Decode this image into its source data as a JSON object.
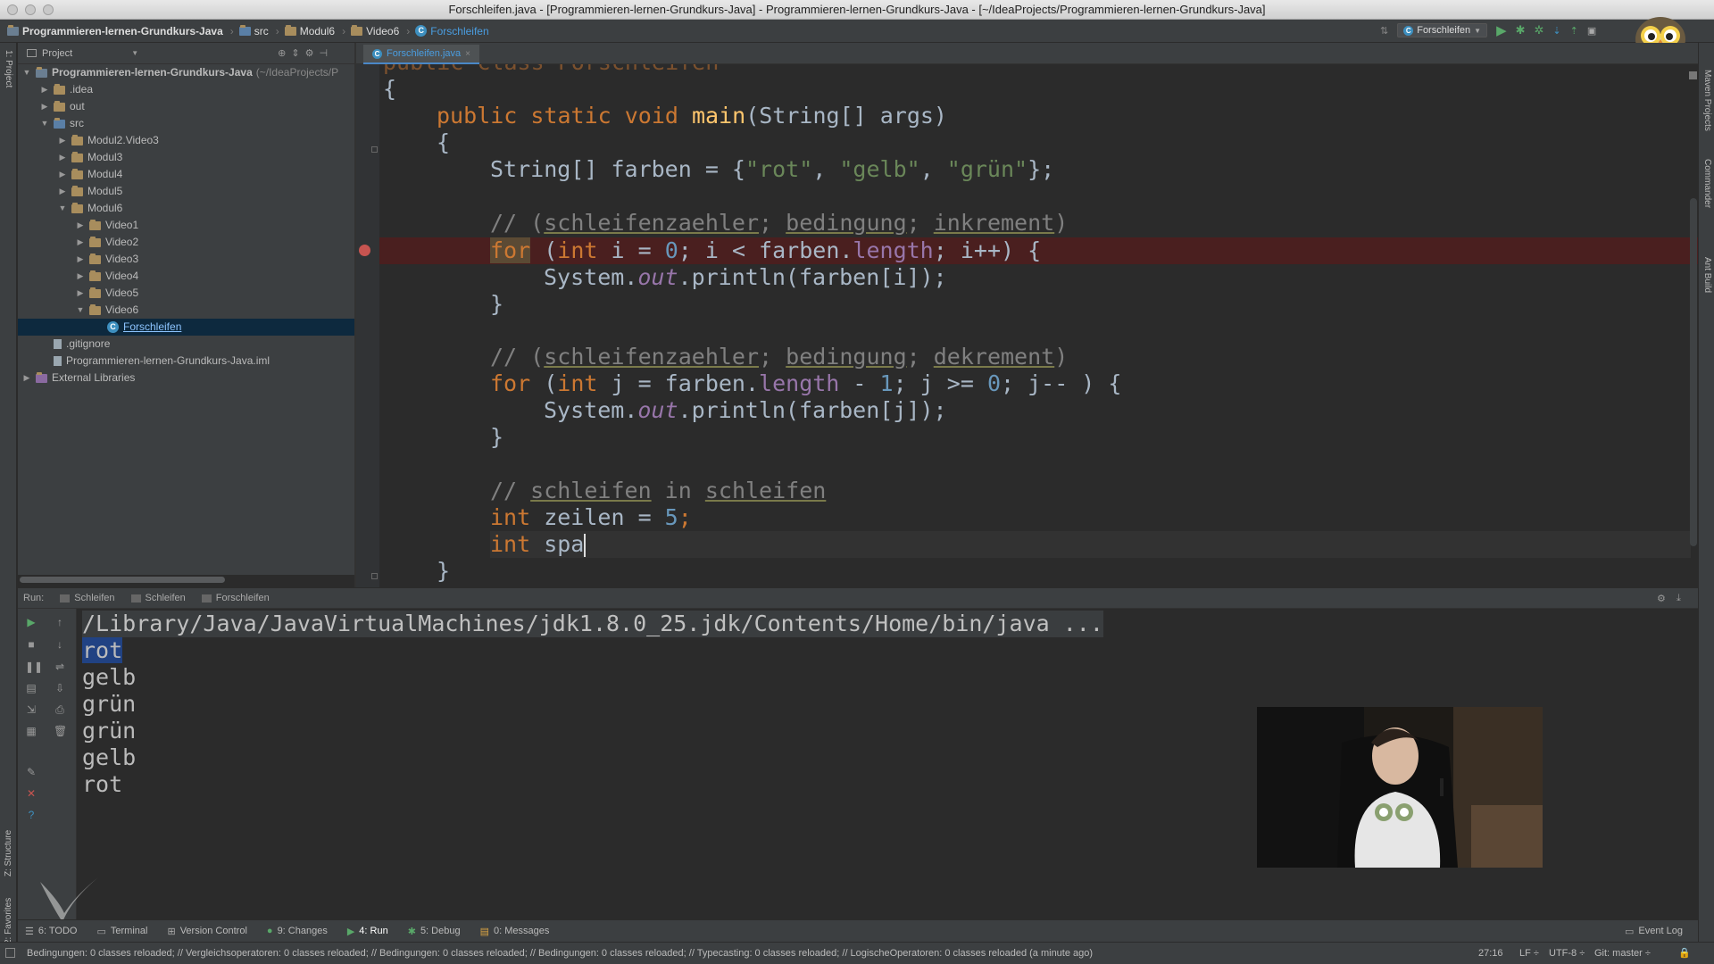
{
  "window_title": "Forschleifen.java - [Programmieren-lernen-Grundkurs-Java] - Programmieren-lernen-Grundkurs-Java - [~/IdeaProjects/Programmieren-lernen-Grundkurs-Java]",
  "breadcrumbs": [
    "Programmieren-lernen-Grundkurs-Java",
    "src",
    "Modul6",
    "Video6",
    "Forschleifen"
  ],
  "run_config": "Forschleifen",
  "project_panel": {
    "label": "Project"
  },
  "tree": [
    {
      "label": "Programmieren-lernen-Grundkurs-Java",
      "sub": "(~/IdeaProjects/P",
      "depth": 0,
      "arrow": "▼",
      "icon": "project-folder-icon"
    },
    {
      "label": ".idea",
      "depth": 1,
      "arrow": "▶",
      "icon": "folder-icon"
    },
    {
      "label": "out",
      "depth": 1,
      "arrow": "▶",
      "icon": "folder-icon"
    },
    {
      "label": "src",
      "depth": 1,
      "arrow": "▼",
      "icon": "source-folder-icon"
    },
    {
      "label": "Modul2.Video3",
      "depth": 2,
      "arrow": "▶",
      "icon": "package-icon"
    },
    {
      "label": "Modul3",
      "depth": 2,
      "arrow": "▶",
      "icon": "package-icon"
    },
    {
      "label": "Modul4",
      "depth": 2,
      "arrow": "▶",
      "icon": "package-icon"
    },
    {
      "label": "Modul5",
      "depth": 2,
      "arrow": "▶",
      "icon": "package-icon"
    },
    {
      "label": "Modul6",
      "depth": 2,
      "arrow": "▼",
      "icon": "package-icon"
    },
    {
      "label": "Video1",
      "depth": 3,
      "arrow": "▶",
      "icon": "package-icon"
    },
    {
      "label": "Video2",
      "depth": 3,
      "arrow": "▶",
      "icon": "package-icon"
    },
    {
      "label": "Video3",
      "depth": 3,
      "arrow": "▶",
      "icon": "package-icon"
    },
    {
      "label": "Video4",
      "depth": 3,
      "arrow": "▶",
      "icon": "package-icon"
    },
    {
      "label": "Video5",
      "depth": 3,
      "arrow": "▶",
      "icon": "package-icon"
    },
    {
      "label": "Video6",
      "depth": 3,
      "arrow": "▼",
      "icon": "package-icon"
    },
    {
      "label": "Forschleifen",
      "depth": 4,
      "arrow": "",
      "icon": "java-class-icon",
      "selected": true
    },
    {
      "label": ".gitignore",
      "depth": 1,
      "arrow": "",
      "icon": "file-icon"
    },
    {
      "label": "Programmieren-lernen-Grundkurs-Java.iml",
      "depth": 1,
      "arrow": "",
      "icon": "module-file-icon"
    },
    {
      "label": "External Libraries",
      "depth": 0,
      "arrow": "▶",
      "icon": "library-icon"
    }
  ],
  "editor_tab": "Forschleifen.java",
  "code": {
    "l0": "public class Forschleifen",
    "l1": "{",
    "l2a": "public static void ",
    "l2b": "main",
    "l2c": "(String[] args)",
    "l3": "{",
    "l4a": "String[] farben = {",
    "l4b": "\"rot\"",
    "l4c": ", ",
    "l4d": "\"gelb\"",
    "l4e": ", ",
    "l4f": "\"grün\"",
    "l4g": "};",
    "l5a": "// (",
    "l5b": "schleifenzaehler",
    "l5c": "; ",
    "l5d": "bedingung",
    "l5e": "; ",
    "l5f": "inkrement",
    "l5g": ")",
    "l6a": "for",
    "l6b": " (",
    "l6c": "int",
    "l6d": " i = ",
    "l6e": "0",
    "l6f": "; i < farben.",
    "l6g": "length",
    "l6h": "; i++) {",
    "l7a": "System.",
    "l7b": "out",
    "l7c": ".println(farben[i]);",
    "l8": "}",
    "l9a": "// (",
    "l9b": "schleifenzaehler",
    "l9c": "; ",
    "l9d": "bedingung",
    "l9e": "; ",
    "l9f": "dekrement",
    "l9g": ")",
    "l10a": "for",
    "l10b": " (",
    "l10c": "int",
    "l10d": " j = farben.",
    "l10e": "length",
    "l10f": " - ",
    "l10g": "1",
    "l10h": "; j >= ",
    "l10i": "0",
    "l10j": "; j-- ) {",
    "l11a": "System.",
    "l11b": "out",
    "l11c": ".println(farben[j]);",
    "l12": "}",
    "l13a": "// ",
    "l13b": "schleifen",
    "l13c": " in ",
    "l13d": "schleifen",
    "l14a": "int",
    "l14b": " zeilen = ",
    "l14c": "5",
    "l14d": ";",
    "l15a": "int",
    "l15b": " spa",
    "l16": "}"
  },
  "run": {
    "label": "Run:",
    "tabs": [
      "Schleifen",
      "Schleifen",
      "Forschleifen"
    ],
    "command": "/Library/Java/JavaVirtualMachines/jdk1.8.0_25.jdk/Contents/Home/bin/java ...",
    "output": [
      "rot",
      "gelb",
      "grün",
      "grün",
      "gelb",
      "rot"
    ]
  },
  "tool_windows": [
    "6: TODO",
    "Terminal",
    "Version Control",
    "9: Changes",
    "4: Run",
    "5: Debug",
    "0: Messages"
  ],
  "event_log": "Event Log",
  "status": {
    "message": "Bedingungen: 0 classes reloaded; // Vergleichsoperatoren: 0 classes reloaded; // Bedingungen: 0 classes reloaded; // Bedingungen: 0 classes reloaded; // Typecasting: 0 classes reloaded; // LogischeOperatoren: 0 classes reloaded (a minute ago)",
    "position": "27:16",
    "line_sep": "LF ÷",
    "encoding": "UTF-8 ÷",
    "git": "Git: master ÷"
  },
  "side_tabs": {
    "project": "1: Project",
    "structure": "Z: Structure",
    "favorites": "2: Favorites",
    "maven": "Maven Projects",
    "commander": "Commander",
    "ant": "Ant Build"
  },
  "colors": {
    "keyword": "#cc7832",
    "string": "#6a8759",
    "number": "#6897bb",
    "comment": "#808080",
    "field": "#9876aa",
    "method": "#ffc66d",
    "breakpoint": "#c75450"
  }
}
